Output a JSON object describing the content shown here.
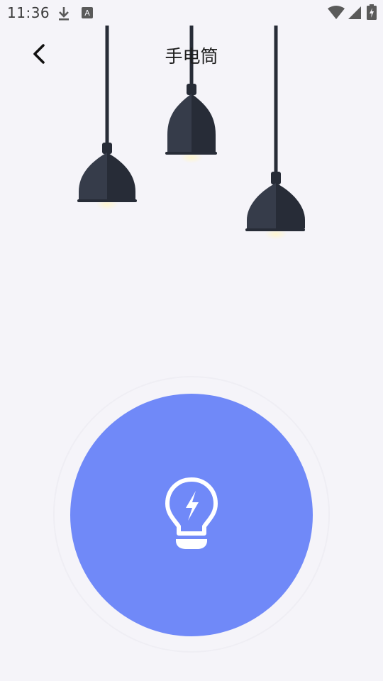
{
  "status_bar": {
    "time": "11:36",
    "icons": [
      "download-icon",
      "keyboard-a-icon",
      "wifi-icon",
      "cellular-signal-icon",
      "battery-charging-icon"
    ]
  },
  "header": {
    "back_icon": "chevron-left-icon",
    "title": "手电筒"
  },
  "lamps": {
    "count": 3,
    "shade_color": "#363c4a",
    "shade_dark_color": "#272c37",
    "glow_color": "#fff8d6"
  },
  "flashlight": {
    "icon": "lightbulb-bolt-icon",
    "button_color": "#7089f8",
    "state": "off"
  }
}
